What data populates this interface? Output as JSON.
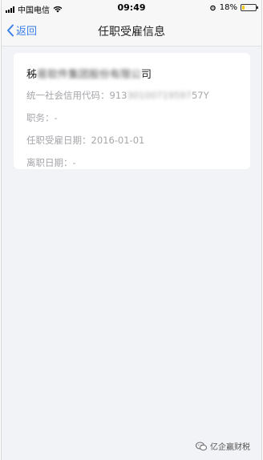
{
  "status_bar": {
    "carrier": "中国电信",
    "time": "09:49",
    "battery_pct": "18%",
    "battery_level": 0.18
  },
  "nav": {
    "back_label": "返回",
    "title": "任职受雇信息"
  },
  "card": {
    "company_prefix": "秭",
    "company_blurred": "易软件集团股份有限公",
    "company_suffix": "司",
    "credit_code_label": "统一社会信用代码：",
    "credit_code_prefix": "913",
    "credit_code_blurred": "30100719597",
    "credit_code_suffix": "57Y",
    "position_label": "职务：",
    "position_value": "-",
    "hire_date_label": "任职受雇日期：",
    "hire_date_value": "2016-01-01",
    "leave_date_label": "离职日期：",
    "leave_date_value": "-"
  },
  "watermark": {
    "text": "亿企赢财税"
  }
}
